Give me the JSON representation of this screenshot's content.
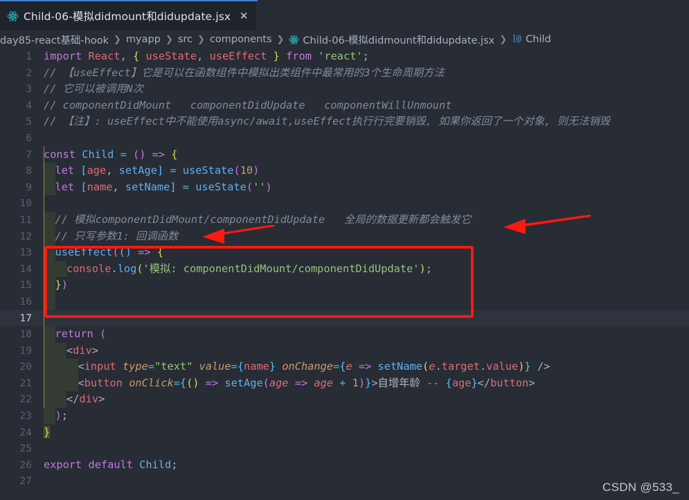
{
  "window": {
    "background": "#272c35",
    "accent": "#3f7fd0"
  },
  "tab_bar": {
    "tabs": [
      {
        "icon": "react-icon",
        "label": "Child-06-模拟didmount和didupdate.jsx",
        "close_label": "✕",
        "active": true
      }
    ]
  },
  "breadcrumb": {
    "items": [
      {
        "label": "day85-react基础-hook",
        "icon": null
      },
      {
        "label": "myapp",
        "icon": null
      },
      {
        "label": "src",
        "icon": null
      },
      {
        "label": "components",
        "icon": null
      },
      {
        "label": "Child-06-模拟didmount和didupdate.jsx",
        "icon": "react-icon"
      },
      {
        "label": "Child",
        "icon": "symbol-variable-icon"
      }
    ],
    "separator": "❯"
  },
  "editor": {
    "language": "jsx",
    "current_line": 17,
    "line_numbers": [
      1,
      2,
      3,
      4,
      5,
      6,
      7,
      8,
      9,
      10,
      11,
      12,
      13,
      14,
      15,
      16,
      17,
      18,
      19,
      20,
      21,
      22,
      23,
      24,
      25,
      26,
      27
    ],
    "lines": [
      "import React, { useState, useEffect } from 'react';",
      "// 【useEffect】它是可以在函数组件中模拟出类组件中最常用的3个生命周期方法",
      "// 它可以被调用N次",
      "// componentDidMount   componentDidUpdate   componentWillUnmount",
      "// 【注】: useEffect中不能使用async/await,useEffect执行行完要销毁, 如果你返回了一个对象, 则无法销毁",
      "",
      "const Child = () => {",
      "    let [age, setAge] = useState(10)",
      "    let [name, setName] = useState('')",
      "",
      "    // 模拟componentDidMount/componentDidUpdate   全局的数据更新都会触发它",
      "    // 只写参数1: 回调函数",
      "    useEffect(() => {",
      "        console.log('模拟: componentDidMount/componentDidUpdate');",
      "    })",
      "",
      "",
      "    return (",
      "        <div>",
      "            <input type=\"text\" value={name} onChange={e => setName(e.target.value)} />",
      "            <button onClick={() => setAge(age => age + 1)}>自增年龄 -- {age}</button>",
      "        </div>",
      "    );",
      "}",
      "",
      "export default Child;",
      ""
    ]
  },
  "annotations": {
    "highlight_box": {
      "color": "#f91a10",
      "covers_lines": "13-16"
    },
    "arrows": [
      {
        "color": "#f91a10",
        "points_to": "全局的数据更新都会触发它",
        "direction": "left"
      },
      {
        "color": "#f91a10",
        "points_to": "回调函数",
        "direction": "left"
      }
    ]
  },
  "watermark": {
    "text": "CSDN @533_"
  }
}
